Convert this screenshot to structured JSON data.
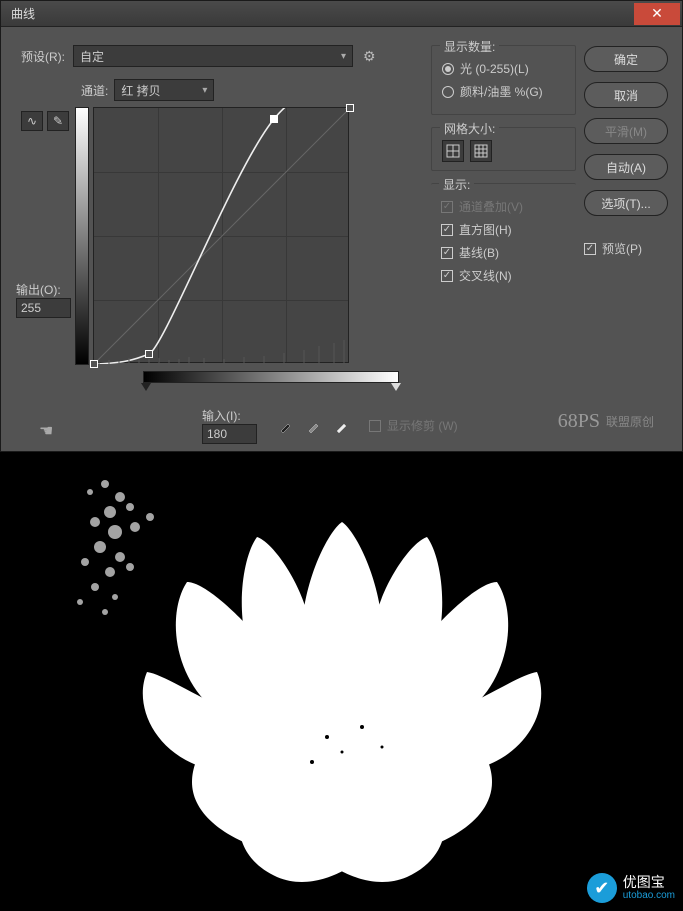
{
  "titlebar": {
    "title": "曲线",
    "close": "✕"
  },
  "preset": {
    "label": "预设(R):",
    "value": "自定",
    "gear": "⚙"
  },
  "channel": {
    "label": "通道:",
    "value": "红 拷贝"
  },
  "output": {
    "label": "输出(O):",
    "value": "255"
  },
  "input": {
    "label": "输入(I):",
    "value": "180"
  },
  "clipping": {
    "label": "显示修剪 (W)"
  },
  "display_amount": {
    "legend": "显示数量:",
    "light": "光 (0-255)(L)",
    "pigment": "颜料/油墨 %(G)"
  },
  "grid_size": {
    "legend": "网格大小:"
  },
  "show": {
    "legend": "显示:",
    "overlay": "通道叠加(V)",
    "histogram": "直方图(H)",
    "baseline": "基线(B)",
    "intersection": "交叉线(N)"
  },
  "buttons": {
    "ok": "确定",
    "cancel": "取消",
    "smooth": "平滑(M)",
    "auto": "自动(A)",
    "options": "选项(T)..."
  },
  "preview": {
    "label": "预览(P)"
  },
  "watermark1": {
    "logo": "68PS",
    "text": "联盟原创"
  },
  "watermark2": {
    "text": "优图宝",
    "sub": "utobao.com"
  },
  "chart_data": {
    "type": "line",
    "title": "曲线",
    "xlabel": "输入",
    "ylabel": "输出",
    "xlim": [
      0,
      255
    ],
    "ylim": [
      0,
      255
    ],
    "series": [
      {
        "name": "曲线",
        "x": [
          0,
          55,
          180,
          255
        ],
        "y": [
          0,
          10,
          245,
          255
        ]
      },
      {
        "name": "基线",
        "x": [
          0,
          255
        ],
        "y": [
          0,
          255
        ]
      }
    ],
    "selected_point": {
      "x": 180,
      "y": 245,
      "output": 255,
      "input": 180
    }
  }
}
